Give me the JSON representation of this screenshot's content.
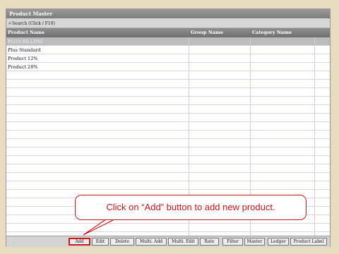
{
  "window": {
    "title": "Product Master"
  },
  "search": {
    "label": "Search (Click / F10)",
    "icon": "search-icon"
  },
  "columns": [
    "Product Name",
    "Group Name",
    "Category Name"
  ],
  "rows": [
    {
      "name": "PLUS BILLING",
      "group": "",
      "category": "",
      "type": "group"
    },
    {
      "name": "Plus Standard",
      "group": "",
      "category": ""
    },
    {
      "name": "Product 12%",
      "group": "",
      "category": ""
    },
    {
      "name": "Product 28%",
      "group": "",
      "category": ""
    }
  ],
  "buttons": [
    "Add",
    "Edit",
    "Delete",
    "Multi. Add",
    "Multi. Edit",
    "Rate",
    "Filter",
    "Master",
    "Ledger",
    "Product Label"
  ],
  "callout": {
    "text": "Click on “Add” button to add new product."
  },
  "colors": {
    "highlight": "#c4161c",
    "background": "#e8dcc0",
    "header": "#7c7c7c"
  }
}
